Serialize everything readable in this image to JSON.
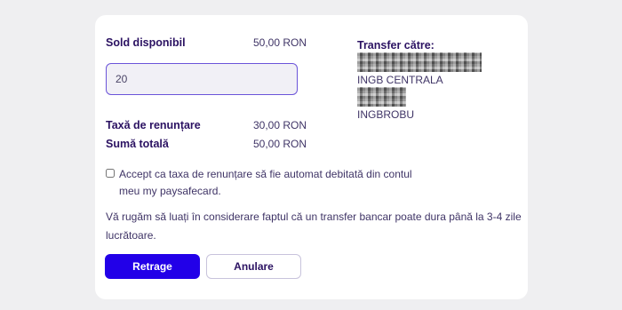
{
  "summary": {
    "available_label": "Sold disponibil",
    "available_value": "50,00 RON",
    "fee_label": "Taxă de renunțare",
    "fee_value": "30,00 RON",
    "total_label": "Sumă totală",
    "total_value": "50,00 RON"
  },
  "amount_input": {
    "value": "20"
  },
  "transfer": {
    "label": "Transfer către:",
    "bank_name": "INGB CENTRALA",
    "bic": "INGBROBU"
  },
  "consent": {
    "line1": "Accept ca taxa de renunțare să fie automat debitată din contul",
    "line2": "meu my paysafecard."
  },
  "notice": {
    "line1": "Vă rugăm să luați în considerare faptul că un transfer bancar poate dura până la 3-4 zile",
    "line2": "lucrătoare."
  },
  "buttons": {
    "withdraw": "Retrage",
    "cancel": "Anulare"
  },
  "colors": {
    "primary": "#2200e8",
    "input_border": "#6b54d9",
    "text_dark": "#2b1262"
  }
}
